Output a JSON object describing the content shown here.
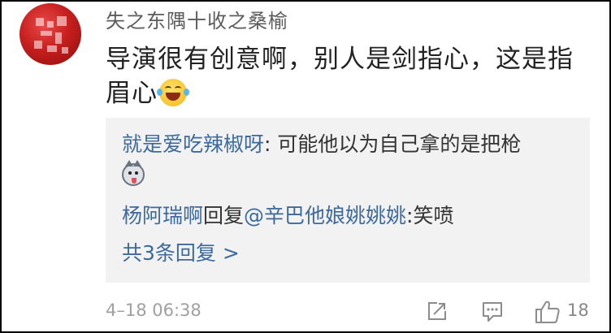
{
  "comment": {
    "username": "失之东隅十收之桑榆",
    "text_line": "导演很有创意啊，别人是剑指心，这是指眉心",
    "emoji": "laughing-tears-emoji"
  },
  "replies": [
    {
      "user": "就是爱吃辣椒呀",
      "separator": ": ",
      "text": "可能他以为自己拿的是把枪",
      "emoji": "husky-emoji"
    },
    {
      "user": "杨阿瑞啊",
      "reply_word": "回复",
      "target": "@辛巴他娘姚姚姚",
      "separator": ":",
      "text": "笑喷"
    }
  ],
  "more_replies_label": "共3条回复 >",
  "footer": {
    "timestamp": "4–18 06:38",
    "like_count": "18",
    "icons": [
      "share-icon",
      "comment-icon",
      "thumbs-up-icon"
    ]
  },
  "colors": {
    "link_blue": "#3d6a9e",
    "reply_bg": "#f2f2f2",
    "meta_gray": "#a0a0a0"
  }
}
